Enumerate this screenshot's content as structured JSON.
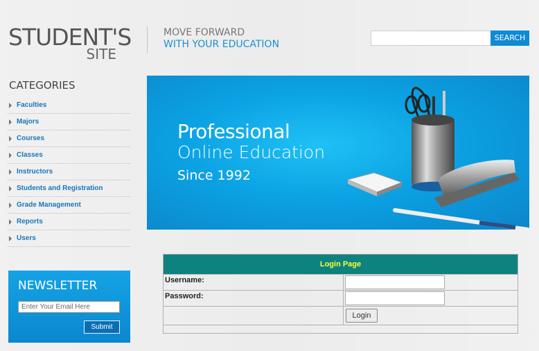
{
  "header": {
    "logo_line1": "STUDENT'S",
    "logo_line2": "SITE",
    "tagline1": "MOVE FORWARD",
    "tagline2": "WITH YOUR EDUCATION",
    "search_placeholder": "",
    "search_button": "SEARCH"
  },
  "sidebar": {
    "title": "CATEGORIES",
    "items": [
      "Faculties",
      "Majors",
      "Courses",
      "Classes",
      "Instructors",
      "Students and Registration",
      "Grade Management",
      "Reports",
      "Users"
    ]
  },
  "newsletter": {
    "title": "NEWSLETTER",
    "email_placeholder": "Enter Your Email Here",
    "submit": "Submit"
  },
  "banner": {
    "line1": "Professional",
    "line2": "Online Education",
    "line3": "Since 1992"
  },
  "login": {
    "title": "Login Page",
    "username_label": "Username:",
    "password_label": "Password:",
    "button": "Login"
  },
  "colors": {
    "accent": "#0f8ad3",
    "login_header_bg": "#0d827f",
    "login_header_text": "#ffff33",
    "link": "#1a75b8"
  }
}
